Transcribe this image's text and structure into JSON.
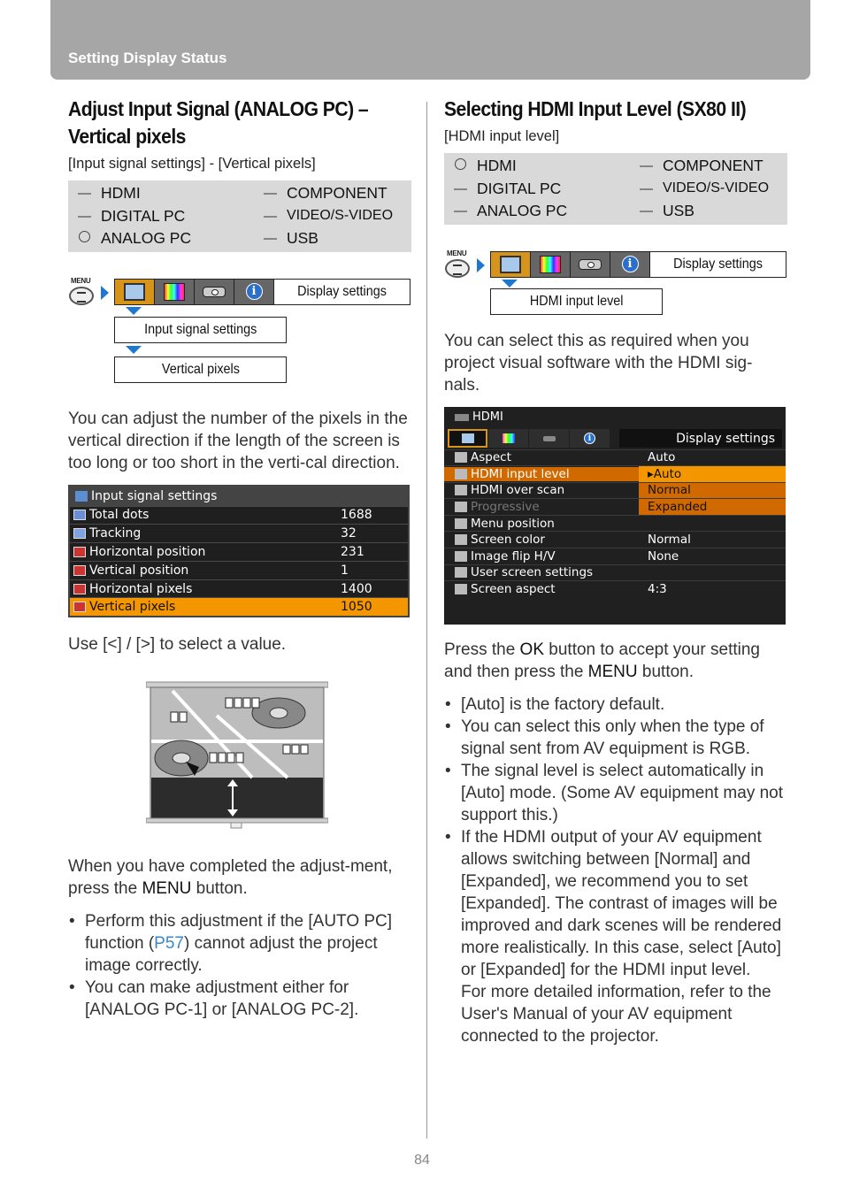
{
  "header": {
    "section": "Setting Display Status"
  },
  "left": {
    "title": "Adjust Input Signal (ANALOG PC) – Vertical pixels",
    "path": "[Input signal settings] - [Vertical pixels]",
    "inputs": [
      {
        "mark": "dash",
        "name": "HDMI"
      },
      {
        "mark": "dash",
        "name": "COMPONENT"
      },
      {
        "mark": "dash",
        "name": "DIGITAL PC"
      },
      {
        "mark": "dash",
        "name": "VIDEO/S-VIDEO"
      },
      {
        "mark": "circle",
        "name": "ANALOG PC"
      },
      {
        "mark": "dash",
        "name": "USB"
      }
    ],
    "menu": {
      "menu_label": "MENU",
      "tab_display": "Display settings",
      "step1": "Input signal settings",
      "step2": "Vertical pixels"
    },
    "para1": "You can adjust the number of the pixels in the vertical direction if the length of the screen is too long or too short in the verti-cal direction.",
    "osd": {
      "title": "Input signal settings",
      "rows": [
        {
          "label": "Total dots",
          "value": "1688",
          "icon": "dots-icon"
        },
        {
          "label": "Tracking",
          "value": "32",
          "icon": "tracking-icon"
        },
        {
          "label": "Horizontal position",
          "value": "231",
          "icon": "horizontal-position-icon"
        },
        {
          "label": "Vertical position",
          "value": "1",
          "icon": "vertical-position-icon"
        },
        {
          "label": "Horizontal pixels",
          "value": "1400",
          "icon": "horizontal-pixels-icon"
        },
        {
          "label": "Vertical pixels",
          "value": "1050",
          "icon": "vertical-pixels-icon",
          "selected": true
        }
      ]
    },
    "para2": "Use [<] / [>] to select a value.",
    "para3_a": "When you have completed the adjust-ment, press the ",
    "para3_key": "MENU",
    "para3_b": " button.",
    "bullets": {
      "b1_a": "Perform this adjustment if the [AUTO PC] function (",
      "b1_link": "P57",
      "b1_b": ") cannot adjust the project image correctly.",
      "b2": "You can make adjustment either for [ANALOG PC-1] or [ANALOG PC-2]."
    }
  },
  "right": {
    "title": "Selecting HDMI Input Level (SX80 II)",
    "path": "[HDMI input level]",
    "inputs": [
      {
        "mark": "circle",
        "name": "HDMI"
      },
      {
        "mark": "dash",
        "name": "COMPONENT"
      },
      {
        "mark": "dash",
        "name": "DIGITAL PC"
      },
      {
        "mark": "dash",
        "name": "VIDEO/S-VIDEO"
      },
      {
        "mark": "dash",
        "name": "ANALOG PC"
      },
      {
        "mark": "dash",
        "name": "USB"
      }
    ],
    "menu": {
      "menu_label": "MENU",
      "tab_display": "Display settings",
      "step1": "HDMI input level"
    },
    "para1": "You can select this as required when you project visual software with the HDMI sig-nals.",
    "osd": {
      "source": "HDMI",
      "tab_display": "Display settings",
      "rows": [
        {
          "label": "Aspect",
          "value": "Auto"
        },
        {
          "label": "HDMI input level",
          "value": "▸Auto",
          "selected": true
        },
        {
          "label": "HDMI over scan",
          "value": "Normal",
          "option": true
        },
        {
          "label": "Progressive",
          "value": "Expanded",
          "option": true,
          "disabled": true
        },
        {
          "label": "Menu position",
          "value": ""
        },
        {
          "label": "Screen color",
          "value": "Normal"
        },
        {
          "label": "Image flip H/V",
          "value": "None"
        },
        {
          "label": "User screen settings",
          "value": ""
        },
        {
          "label": "Screen aspect",
          "value": "4:3"
        }
      ]
    },
    "para2_a": "Press the ",
    "para2_key1": "OK",
    "para2_b": " button to accept your setting and then press the ",
    "para2_key2": "MENU",
    "para2_c": " button.",
    "bullets": [
      "[Auto] is the factory default.",
      "You can select this only when the type of signal sent from AV equipment is RGB.",
      "The signal level is select automatically in [Auto] mode. (Some AV equipment may not support this.)",
      "If the HDMI output of your AV equipment allows switching between [Normal] and [Expanded], we recommend you to set [Expanded]. The contrast of images will be improved and dark scenes will be rendered more realistically. In this case, select [Auto] or [Expanded] for the HDMI input level."
    ],
    "bullet4_extra": "For more detailed information, refer to the User's Manual of your AV equipment connected to the projector."
  },
  "footer": {
    "page": "84"
  }
}
